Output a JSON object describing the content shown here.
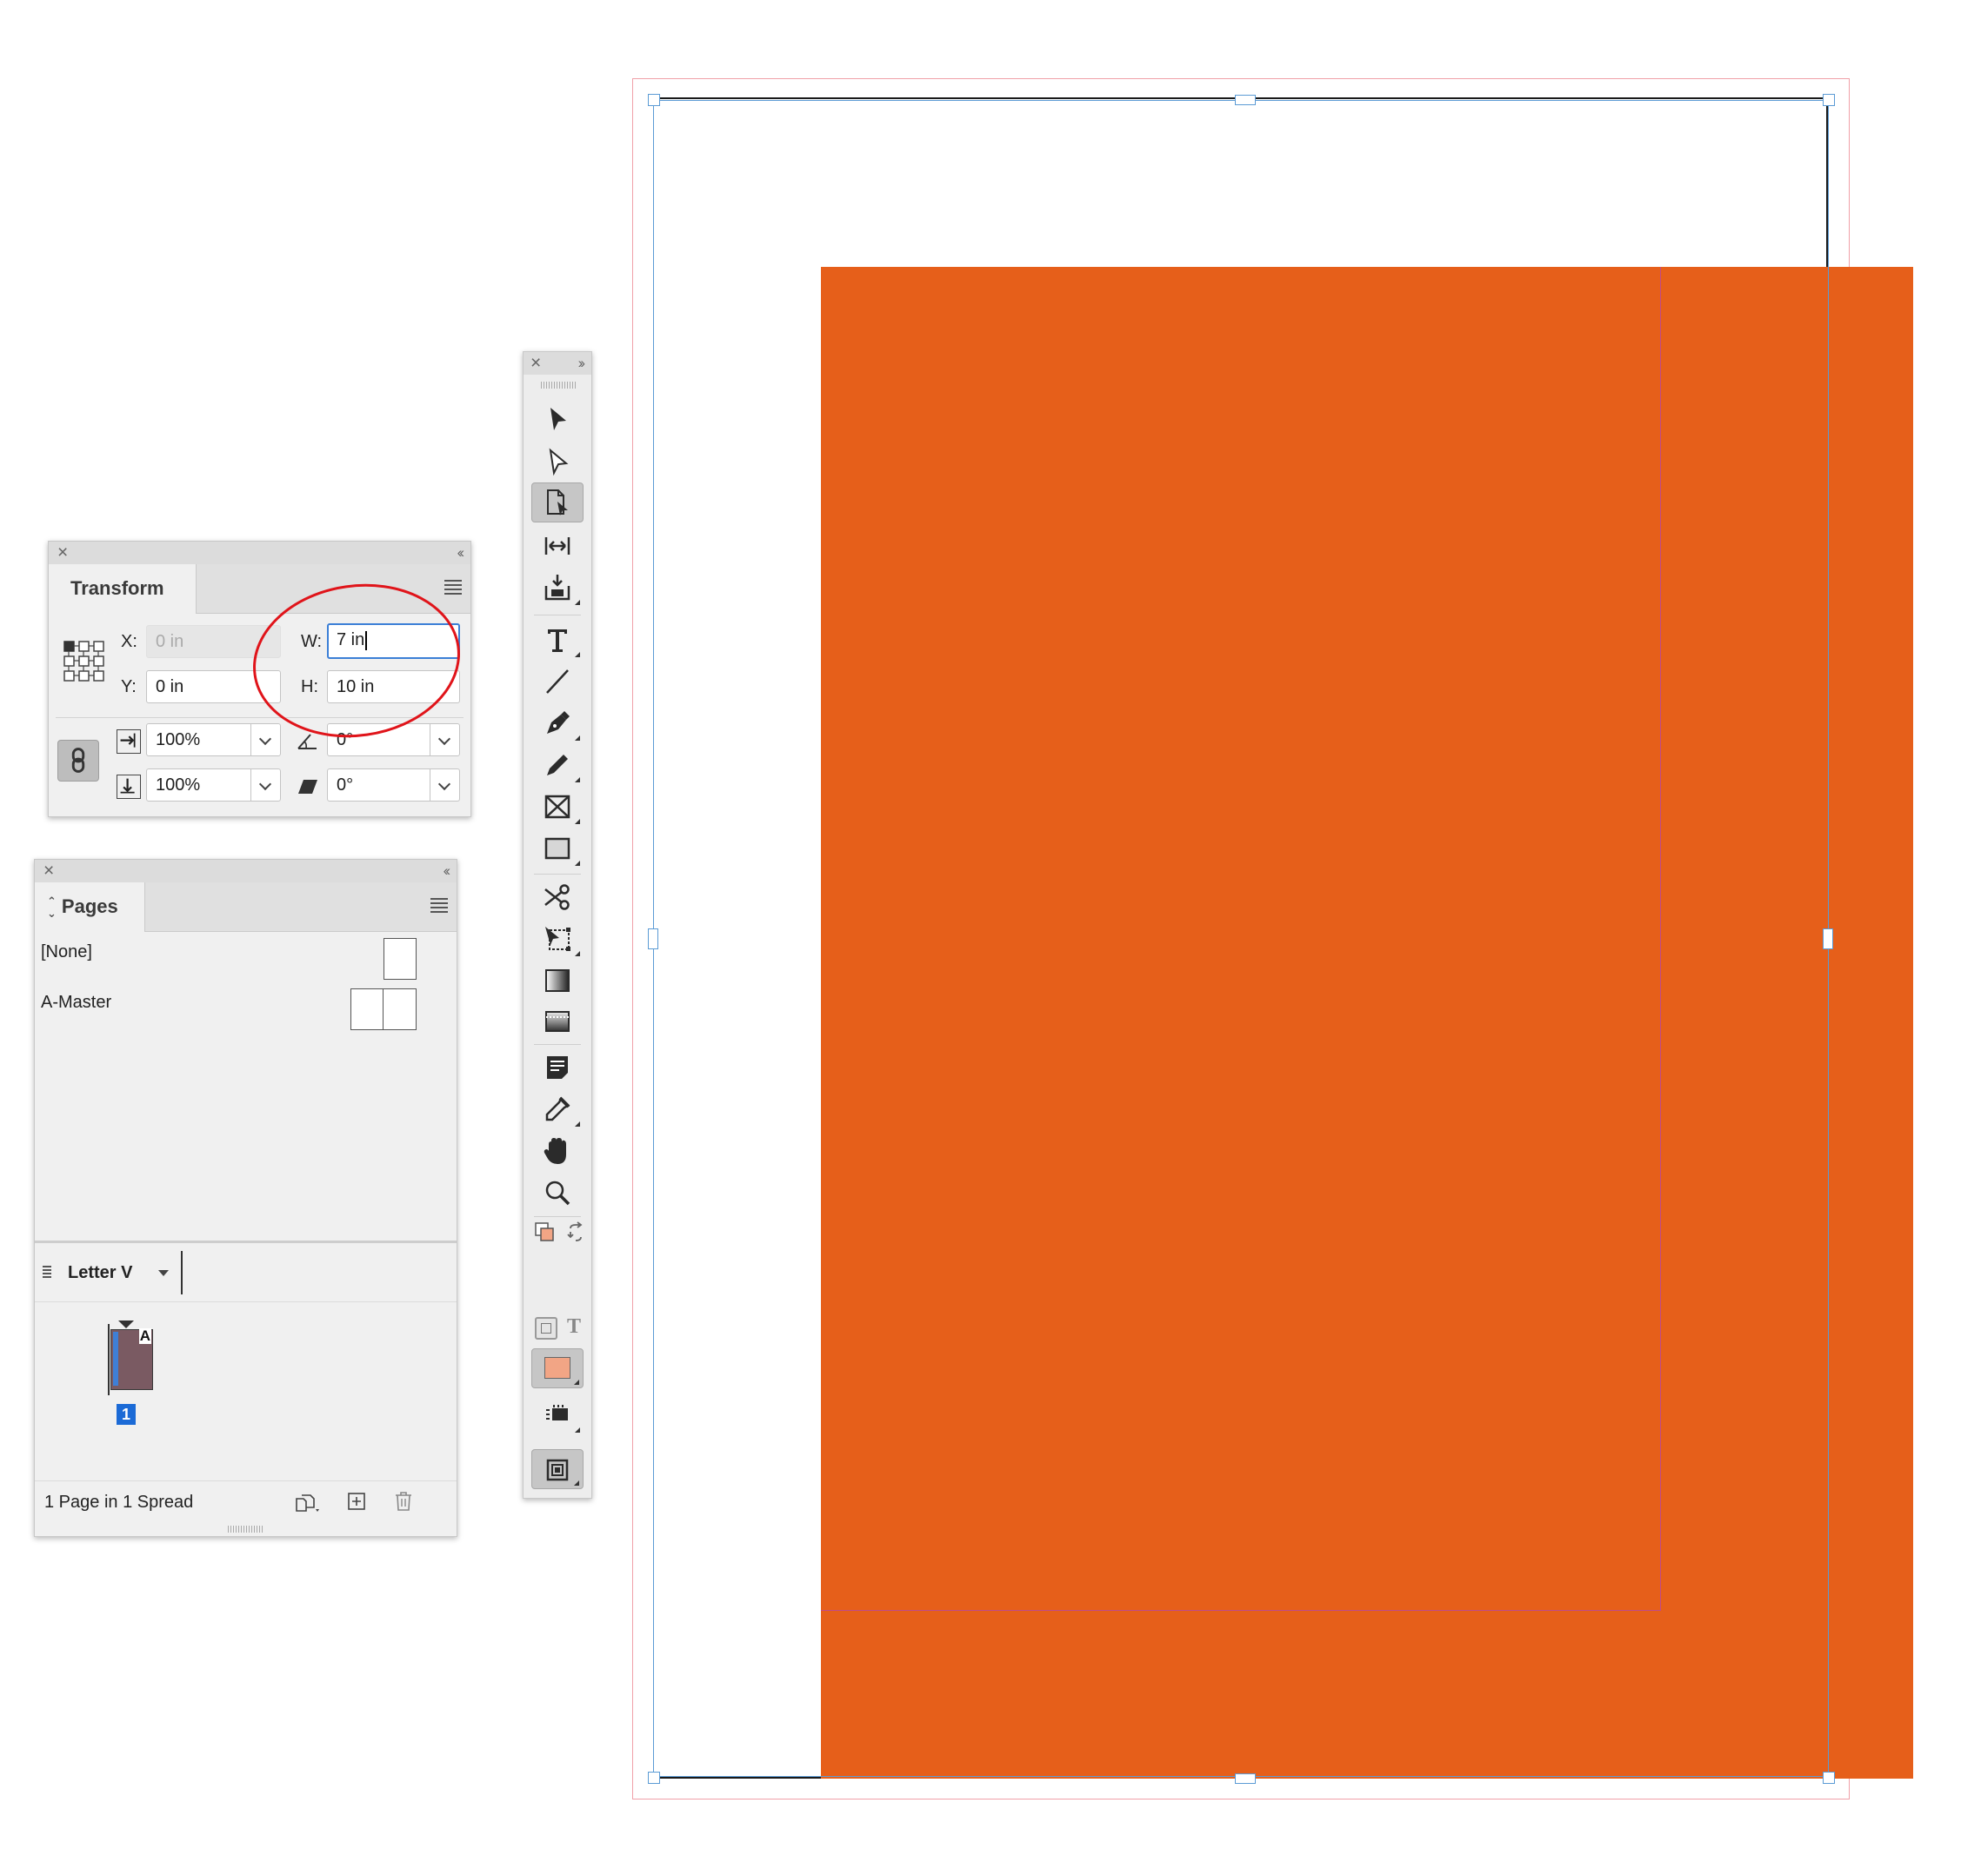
{
  "transform": {
    "tab_label": "Transform",
    "x_label": "X:",
    "x_value": "0 in",
    "y_label": "Y:",
    "y_value": "0 in",
    "w_label": "W:",
    "w_value": "7 in",
    "h_label": "H:",
    "h_value": "10 in",
    "scale_x_value": "100%",
    "scale_y_value": "100%",
    "rotate_value": "0°",
    "shear_value": "0°"
  },
  "pages": {
    "tab_label": "Pages",
    "masters": [
      {
        "label": "[None]"
      },
      {
        "label": "A-Master"
      }
    ],
    "size_label": "Letter V",
    "page_master_letter": "A",
    "page_number": "1",
    "status": "1 Page in 1 Spread"
  },
  "toolbox": {
    "stroke_fill_letter": "T"
  },
  "colors": {
    "fill_orange": "#e65f1a",
    "swatch_orange": "#f2a585",
    "annotation_red": "#e0141a",
    "selection_blue": "#5b9bd5",
    "bleed_red": "#f0a0a8",
    "page_thumb": "#7a5a62",
    "page_number_bg": "#1b6ad6"
  }
}
